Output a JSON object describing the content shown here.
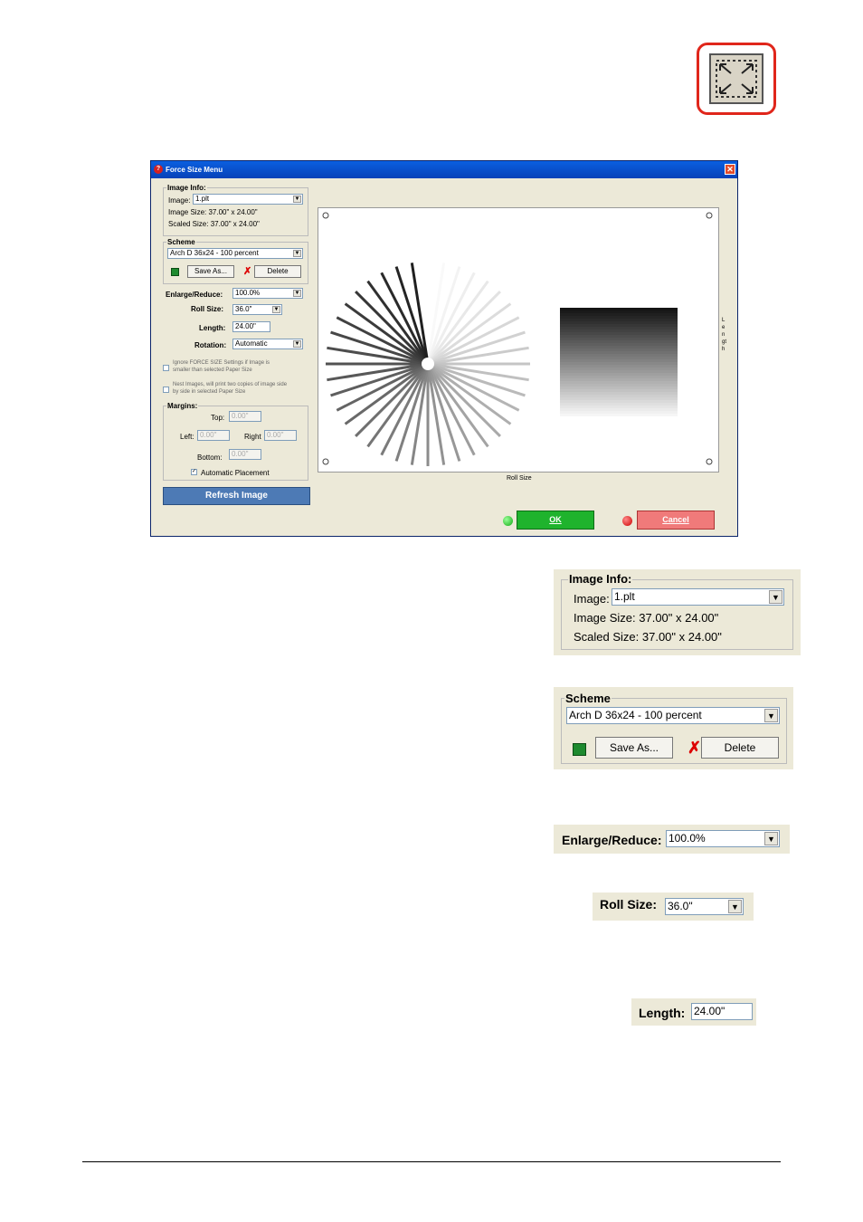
{
  "dialog": {
    "title": "Force Size Menu",
    "close_glyph": "✕",
    "image_info": {
      "title": "Image Info:",
      "image_label": "Image:",
      "image_value": "1.plt",
      "image_size": "Image Size: 37.00\" x 24.00\"",
      "scaled_size": "Scaled Size: 37.00\" x 24.00\""
    },
    "scheme": {
      "title": "Scheme",
      "value": "Arch D 36x24 - 100 percent",
      "save_as": "Save As...",
      "delete": "Delete"
    },
    "enlarge_label": "Enlarge/Reduce:",
    "enlarge_value": "100.0%",
    "roll_label": "Roll Size:",
    "roll_value": "36.0\"",
    "length_label": "Length:",
    "length_value": "24.00\"",
    "rotation_label": "Rotation:",
    "rotation_value": "Automatic",
    "ignore_text_1": "Ignore FORCE SIZE Settings if Image is",
    "ignore_text_2": "smaller than selected Paper Size",
    "nest_text_1": "Nest Images, will print two copies of image side",
    "nest_text_2": "by side in selected Paper Size",
    "margins": {
      "title": "Margins:",
      "top_label": "Top:",
      "top_value": "0.00\"",
      "left_label": "Left:",
      "left_value": "0.00\"",
      "right_label": "Right",
      "right_value": "0.00\"",
      "bottom_label": "Bottom:",
      "bottom_value": "0.00\"",
      "auto_label": "Automatic Placement"
    },
    "refresh": "Refresh Image",
    "ok": "OK",
    "cancel": "Cancel",
    "preview": {
      "roll_size_caption": "Roll Size",
      "length_caption": "Length"
    }
  },
  "zoom": {
    "image_info": {
      "title": "Image Info:",
      "image_label": "Image:",
      "image_value": "1.plt",
      "image_size": "Image Size: 37.00\" x 24.00\"",
      "scaled_size": "Scaled Size: 37.00\" x 24.00\""
    },
    "scheme": {
      "title": "Scheme",
      "value": "Arch D 36x24 - 100 percent",
      "save_as": "Save As...",
      "delete": "Delete"
    },
    "enlarge_label": "Enlarge/Reduce:",
    "enlarge_value": "100.0%",
    "roll_label": "Roll Size:",
    "roll_value": "36.0\"",
    "length_label": "Length:",
    "length_value": "24.00\""
  },
  "colors": {
    "ok": "#1fb32d",
    "cancel": "#f07a7a",
    "refresh": "#4d7ab5",
    "icon_border": "#e0261b"
  },
  "icons": [
    "force-size-icon",
    "help-icon",
    "close-icon",
    "save-disk-icon",
    "delete-x-icon",
    "green-status-dot",
    "red-status-dot"
  ]
}
